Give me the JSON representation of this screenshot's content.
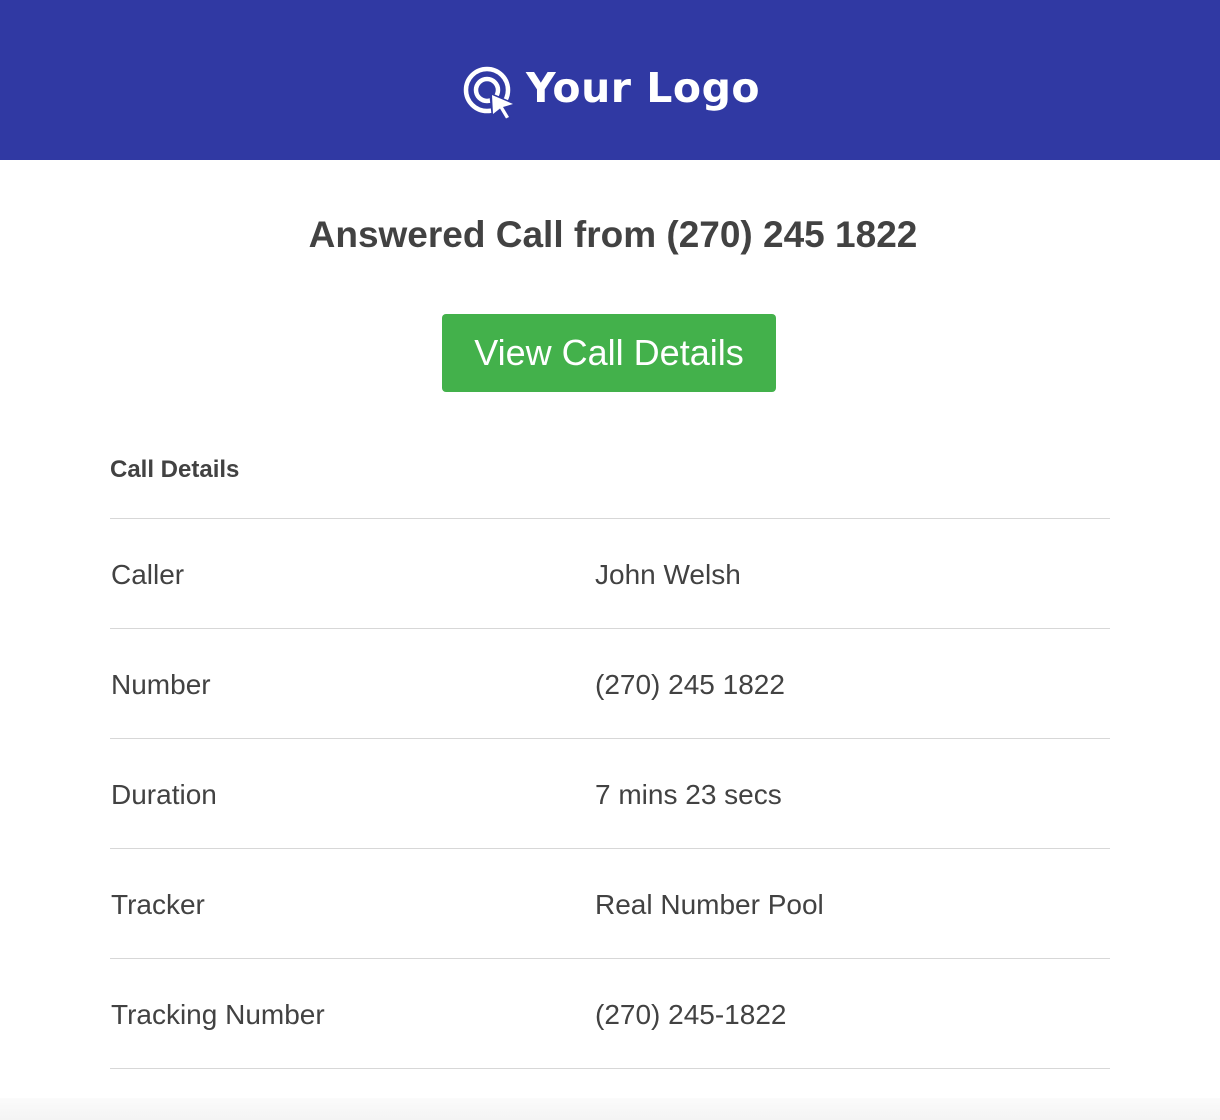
{
  "header": {
    "logo_text": "Your Logo",
    "logo_icon": "cursor-target-icon",
    "background_color": "#3039a3"
  },
  "title": "Answered Call from (270) 245 1822",
  "cta": {
    "label": "View Call Details",
    "color": "#43b14b"
  },
  "details": {
    "heading": "Call Details",
    "rows": [
      {
        "label": "Caller",
        "value": "John Welsh"
      },
      {
        "label": "Number",
        "value": "(270) 245 1822"
      },
      {
        "label": "Duration",
        "value": "7 mins 23 secs"
      },
      {
        "label": "Tracker",
        "value": "Real Number Pool"
      },
      {
        "label": "Tracking Number",
        "value": "(270) 245-1822"
      }
    ]
  }
}
